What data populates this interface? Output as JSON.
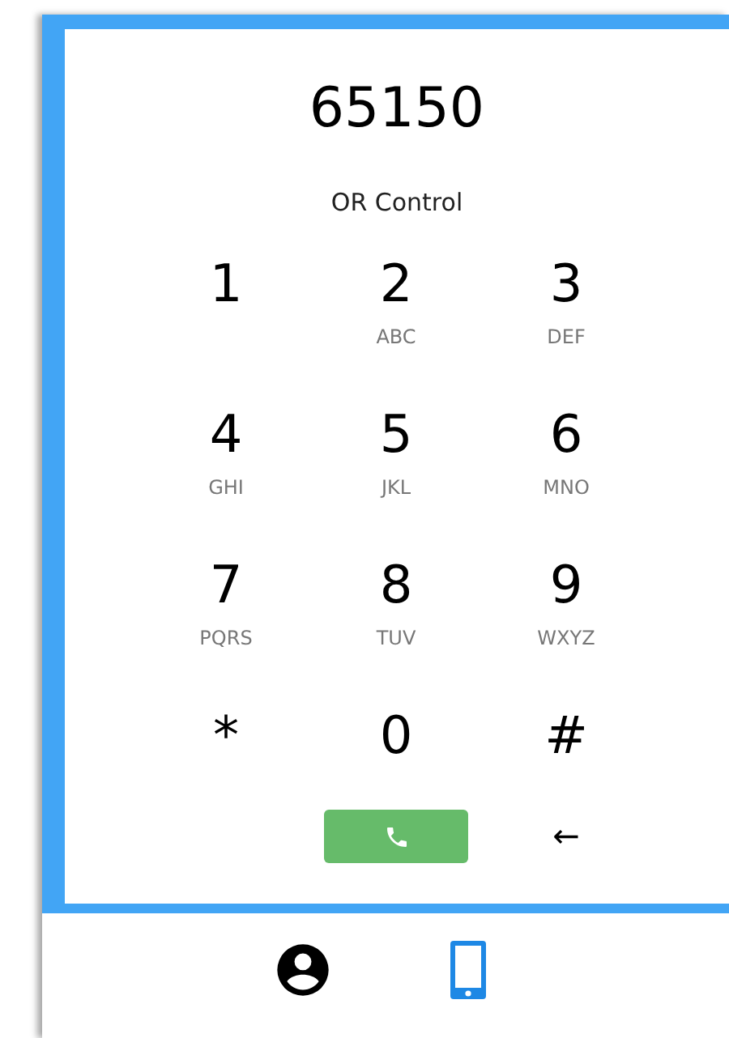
{
  "dialed_number": "65150",
  "label": "OR Control",
  "keys": [
    {
      "digit": "1"
    },
    {
      "digit": "2",
      "letters": "ABC"
    },
    {
      "digit": "3",
      "letters": "DEF"
    },
    {
      "digit": "4",
      "letters": "GHI"
    },
    {
      "digit": "5",
      "letters": "JKL"
    },
    {
      "digit": "6",
      "letters": "MNO"
    },
    {
      "digit": "7",
      "letters": "PQRS"
    },
    {
      "digit": "8",
      "letters": "TUV"
    },
    {
      "digit": "9",
      "letters": "WXYZ"
    },
    {
      "digit": "*"
    },
    {
      "digit": "0"
    },
    {
      "digit": "#"
    }
  ],
  "backspace": "←",
  "nav": [
    {
      "kind": "profile",
      "selected": false
    },
    {
      "kind": "phone",
      "selected": true
    }
  ]
}
